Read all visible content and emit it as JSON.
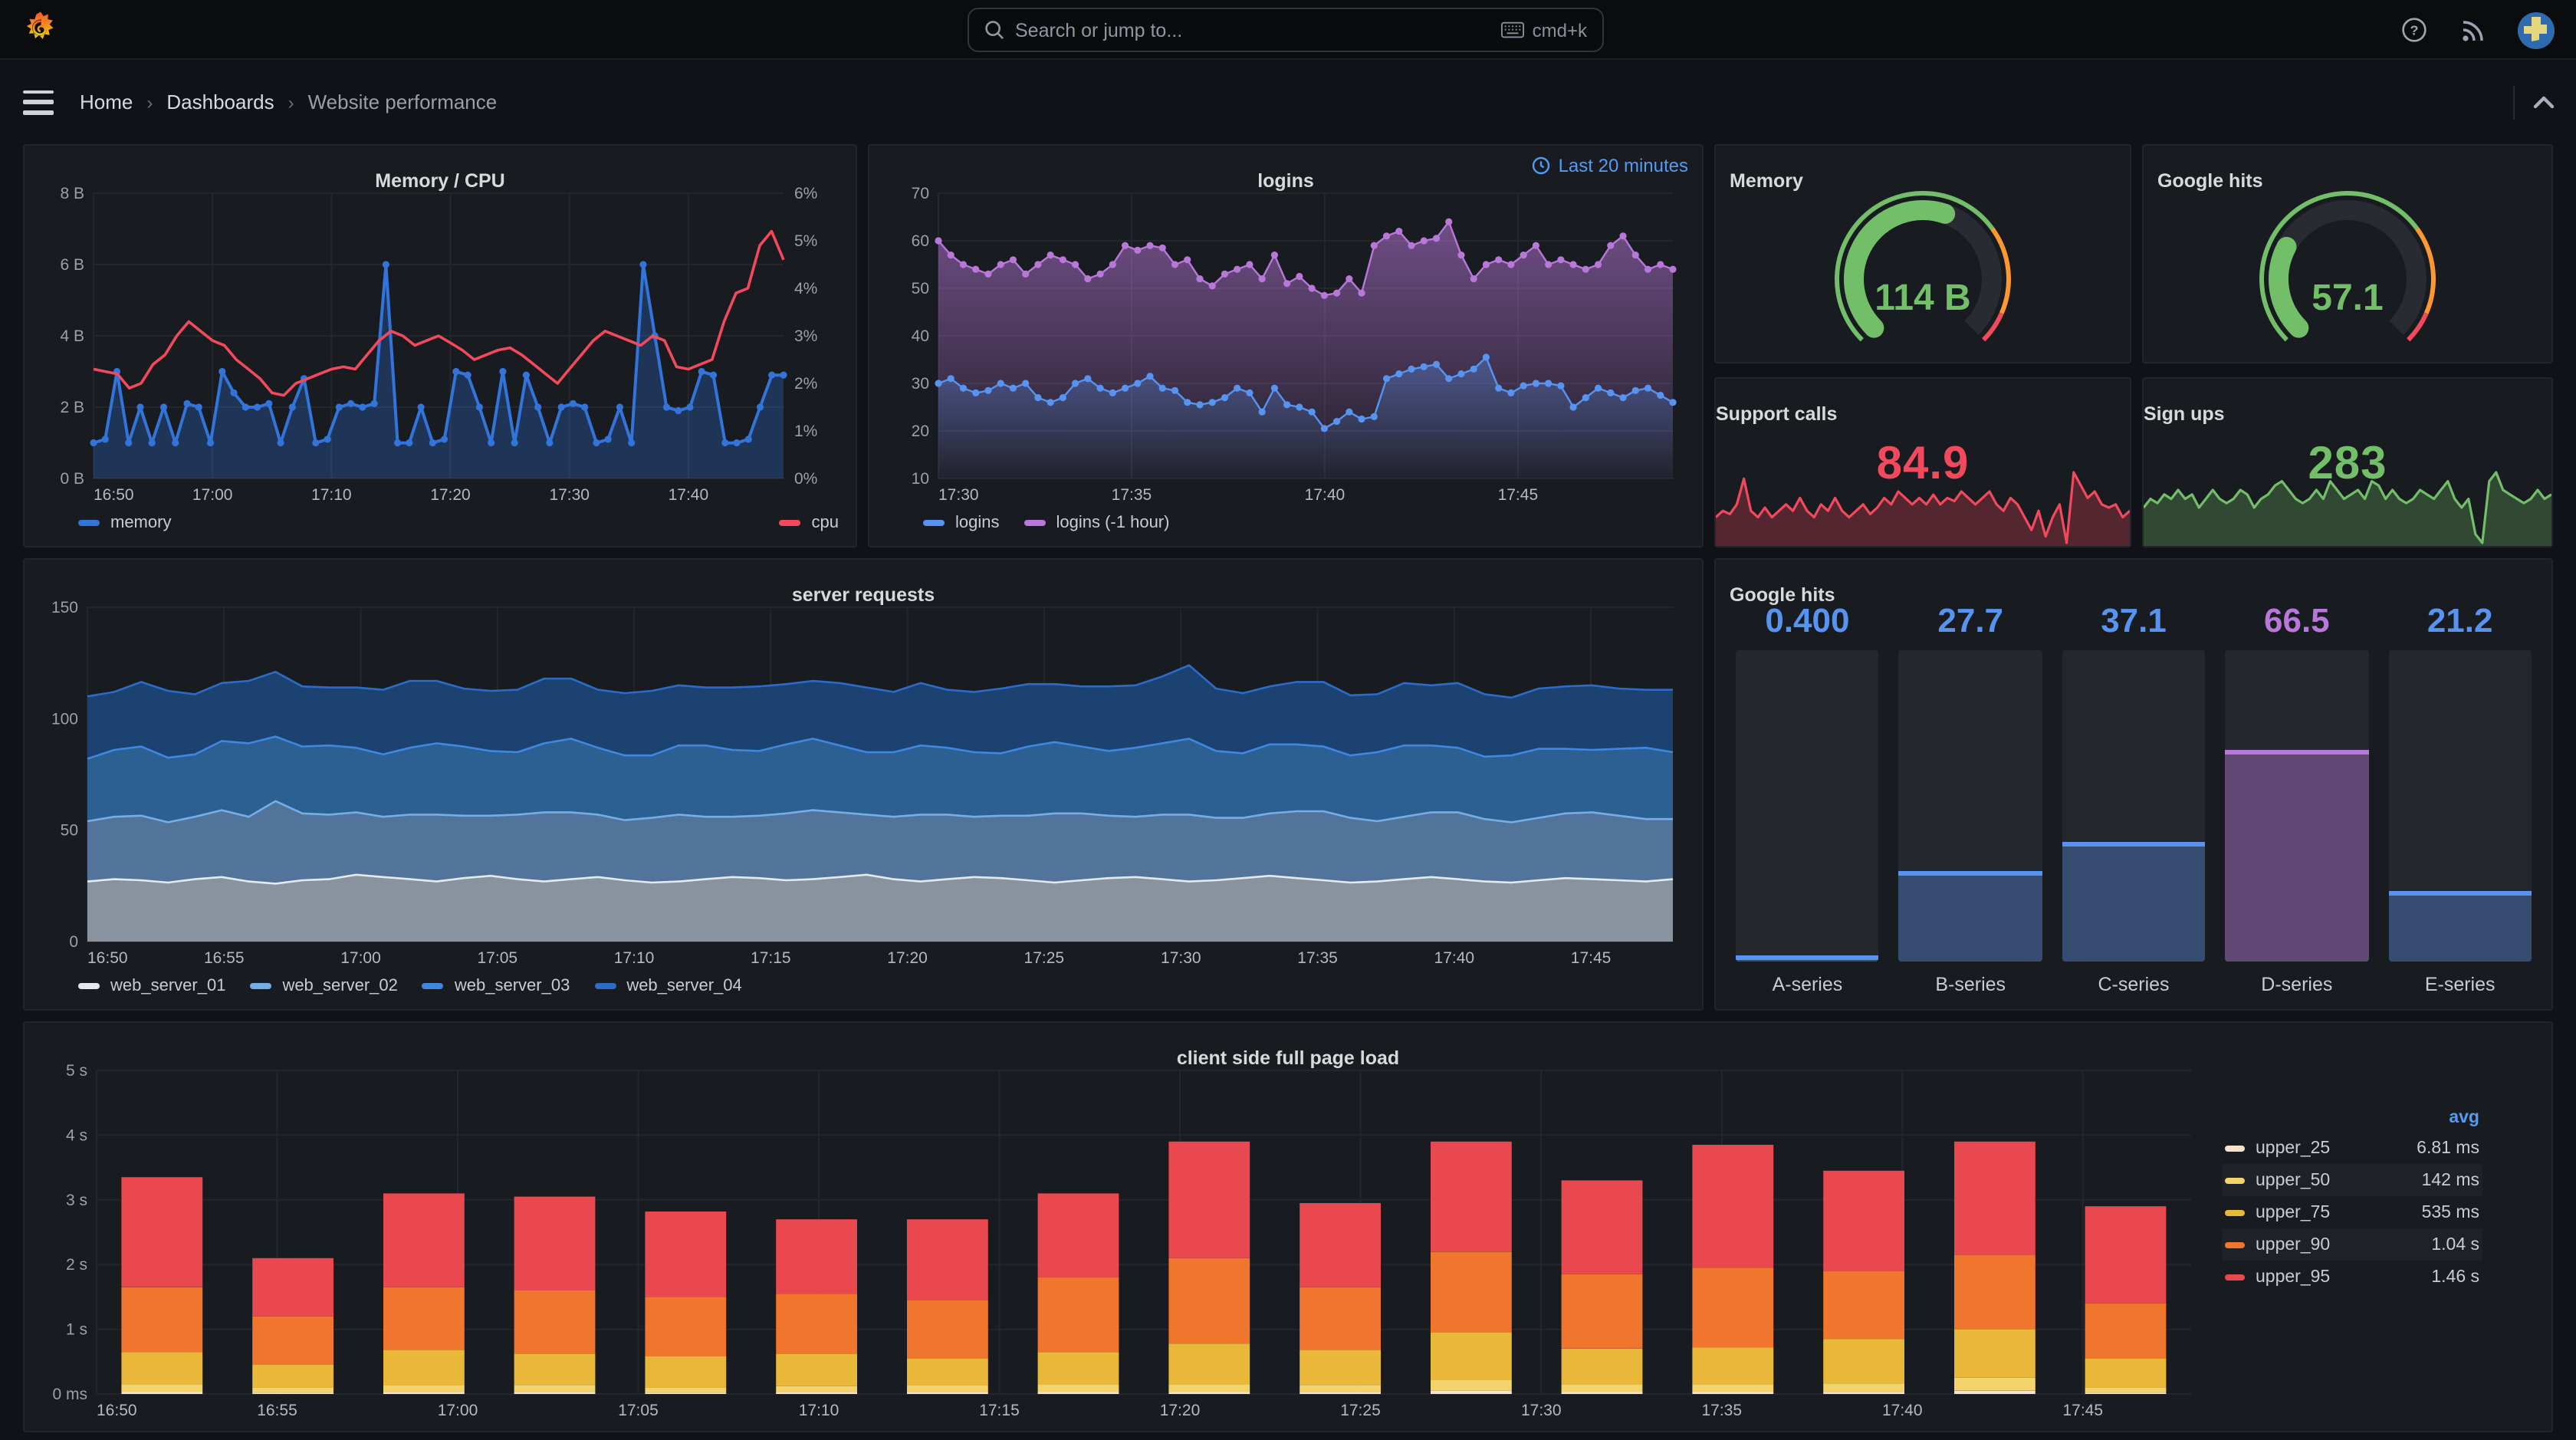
{
  "topnav": {
    "search_placeholder": "Search or jump to...",
    "shortcut": "cmd+k"
  },
  "breadcrumb": {
    "items": [
      "Home",
      "Dashboards",
      "Website performance"
    ]
  },
  "colors": {
    "blue": "#5794F2",
    "dark_blue": "#3274D9",
    "purple": "#B877D9",
    "green": "#73BF69",
    "red": "#F2495C",
    "orange": "#FF780A",
    "yellow": "#EAB839",
    "accent_text": "#539bf5"
  },
  "chart_data": {
    "memory_cpu": {
      "type": "line",
      "title": "Memory / CPU",
      "x_ticks": [
        "16:50",
        "17:00",
        "17:10",
        "17:20",
        "17:30",
        "17:40"
      ],
      "x_tick_fracs": [
        0,
        0.1724,
        0.3448,
        0.5172,
        0.6897,
        0.8621
      ],
      "y_left": {
        "ticks": [
          "0 B",
          "2 B",
          "4 B",
          "6 B",
          "8 B"
        ],
        "min": 0,
        "max": 8
      },
      "y_right": {
        "ticks": [
          "0%",
          "1%",
          "2%",
          "3%",
          "4%",
          "5%",
          "6%"
        ],
        "min": 0,
        "max": 6
      },
      "series": [
        {
          "name": "memory",
          "color": "#3274D9",
          "axis": "left",
          "dots": true,
          "width": 2,
          "fill": "rgba(50,116,217,0.30)",
          "values": [
            1,
            1.1,
            3,
            1,
            2,
            1,
            2,
            1,
            2.1,
            2,
            1,
            3,
            2.4,
            2,
            2,
            2.1,
            1,
            2,
            2.8,
            1,
            1.1,
            2,
            2.1,
            2,
            2.1,
            6,
            1,
            1,
            2,
            1,
            1.1,
            3,
            2.9,
            2,
            1,
            3,
            1,
            2.9,
            2,
            1,
            2,
            2.1,
            2,
            1,
            1.1,
            2,
            1,
            6,
            4,
            2,
            1.9,
            2,
            3,
            2.9,
            1,
            1,
            1.1,
            2,
            2.9,
            2.9
          ]
        },
        {
          "name": "cpu",
          "color": "#F2495C",
          "axis": "right",
          "dots": false,
          "width": 1.8,
          "fill": null,
          "values": [
            2.3,
            2.25,
            2.2,
            1.9,
            2.0,
            2.4,
            2.6,
            3.0,
            3.3,
            3.1,
            2.9,
            2.8,
            2.5,
            2.3,
            2.1,
            1.8,
            1.75,
            2.0,
            2.1,
            2.2,
            2.3,
            2.35,
            2.3,
            2.6,
            2.9,
            3.1,
            3.0,
            2.8,
            2.9,
            3.0,
            2.85,
            2.7,
            2.5,
            2.6,
            2.7,
            2.75,
            2.6,
            2.4,
            2.2,
            2.0,
            2.3,
            2.6,
            2.9,
            3.1,
            3.0,
            2.9,
            2.8,
            3.0,
            2.9,
            2.35,
            2.3,
            2.4,
            2.5,
            3.3,
            3.9,
            4.0,
            4.9,
            5.2,
            4.6
          ]
        }
      ],
      "legend_layout": "split"
    },
    "logins": {
      "type": "line",
      "title": "logins",
      "time_range": "Last 20 minutes",
      "x_ticks": [
        "17:30",
        "17:35",
        "17:40",
        "17:45"
      ],
      "x_tick_fracs": [
        0,
        0.263,
        0.526,
        0.789
      ],
      "y_left": {
        "ticks": [
          "10",
          "20",
          "30",
          "40",
          "50",
          "60",
          "70"
        ],
        "min": 10,
        "max": 70
      },
      "series": [
        {
          "name": "logins (-1 hour)",
          "color": "#B877D9",
          "axis": "left",
          "dots": true,
          "width": 1.2,
          "fill": "gradient:rgba(184,119,217,0.55):rgba(184,119,217,0.05)",
          "values": [
            60,
            57,
            55,
            54,
            53,
            55,
            56,
            53,
            55,
            57,
            56,
            55,
            52,
            53,
            55,
            59,
            58,
            59,
            58.5,
            55,
            56,
            52,
            50.5,
            53,
            54,
            55,
            52,
            57,
            51,
            52.5,
            50,
            48.5,
            49,
            52,
            49,
            59,
            61,
            62,
            59,
            60,
            60.5,
            64,
            57,
            52,
            55,
            56,
            55,
            57,
            59,
            55,
            56,
            55,
            54,
            55,
            59,
            61,
            57,
            54,
            55,
            54
          ],
          "legend_order": 2
        },
        {
          "name": "logins",
          "color": "#5794F2",
          "axis": "left",
          "dots": true,
          "width": 1.2,
          "fill": "gradient:rgba(87,148,242,0.35):rgba(87,148,242,0.02)",
          "values": [
            30,
            31,
            29,
            28,
            28.5,
            30,
            29,
            30,
            27,
            26,
            27,
            30,
            31,
            29,
            28,
            29,
            30,
            31.5,
            29,
            28.5,
            26,
            25.5,
            26,
            27,
            29,
            28,
            24,
            29,
            25.5,
            25,
            24,
            20.5,
            22,
            24,
            22.5,
            23,
            31,
            32,
            33,
            33.5,
            34,
            31,
            32,
            33,
            35.5,
            29,
            28,
            29.5,
            30,
            30,
            29.5,
            25,
            27,
            29,
            28,
            27,
            28.5,
            29,
            27.5,
            26
          ],
          "legend_order": 1
        }
      ],
      "legend_layout": "row"
    },
    "memory_gauge": {
      "type": "gauge",
      "title": "Memory",
      "value": "114 B",
      "fraction": 0.57,
      "value_color": "#73BF69",
      "thresholds": [
        [
          0,
          0.7,
          "#73BF69"
        ],
        [
          0.7,
          0.92,
          "#FF9830"
        ],
        [
          0.92,
          1,
          "#F2495C"
        ]
      ]
    },
    "google_gauge": {
      "type": "gauge",
      "title": "Google hits",
      "value": "57.1",
      "fraction": 0.27,
      "value_color": "#73BF69",
      "thresholds": [
        [
          0,
          0.7,
          "#73BF69"
        ],
        [
          0.7,
          0.92,
          "#FF9830"
        ],
        [
          0.92,
          1,
          "#F2495C"
        ]
      ]
    },
    "support_calls": {
      "type": "stat",
      "title": "Support calls",
      "value": "84.9",
      "color": "#F2495C",
      "spark": [
        12,
        13,
        12.5,
        14,
        18,
        13,
        12,
        13.5,
        12,
        13,
        14,
        13,
        15,
        13,
        12,
        14,
        13,
        15,
        13,
        12,
        13,
        14,
        12.5,
        13.5,
        15,
        14,
        16,
        15,
        14,
        15,
        14,
        15.5,
        14,
        15,
        14.5,
        16,
        15,
        14,
        15,
        16,
        14,
        13,
        15,
        14,
        12,
        10,
        13,
        9,
        12,
        14,
        8,
        19,
        17,
        15,
        16,
        14,
        13.5,
        14,
        12,
        13
      ]
    },
    "sign_ups": {
      "type": "stat",
      "title": "Sign ups",
      "value": "283",
      "color": "#73BF69",
      "spark": [
        6,
        7,
        6.5,
        7.5,
        7,
        8,
        7,
        7.5,
        6,
        7,
        8,
        7,
        6.5,
        7,
        8,
        7.5,
        6,
        7,
        7.5,
        8.5,
        9,
        8,
        7,
        6.5,
        7,
        8,
        7,
        9,
        8,
        7,
        7.5,
        8,
        7,
        9,
        8.5,
        7,
        8,
        7,
        6.5,
        7,
        8,
        7.5,
        7,
        8,
        9,
        7,
        6,
        7,
        3,
        2,
        9,
        10,
        8,
        7.5,
        7,
        6.5,
        7,
        8,
        7,
        7.5
      ]
    },
    "server_requests": {
      "type": "area",
      "title": "server requests",
      "x_ticks": [
        "16:50",
        "16:55",
        "17:00",
        "17:05",
        "17:10",
        "17:15",
        "17:20",
        "17:25",
        "17:30",
        "17:35",
        "17:40",
        "17:45"
      ],
      "x_tick_fracs": [
        0,
        0.0862,
        0.1724,
        0.2586,
        0.3448,
        0.431,
        0.5172,
        0.6034,
        0.6897,
        0.7759,
        0.8621,
        0.9483
      ],
      "y_left": {
        "ticks": [
          "0",
          "50",
          "100",
          "150"
        ],
        "min": 0,
        "max": 150
      },
      "series": [
        {
          "name": "web_server_01",
          "color": "#E4E9EE",
          "fill": "#88939F",
          "values": [
            27,
            28,
            27.5,
            26.5,
            28,
            29,
            27,
            26,
            27.5,
            28,
            30,
            29,
            28,
            27,
            28.5,
            29.5,
            28,
            27,
            28,
            29,
            27.5,
            26.5,
            27,
            28,
            29,
            28.5,
            27.5,
            28,
            29,
            30,
            28,
            27,
            28,
            29,
            28.5,
            27.5,
            26.5,
            27.5,
            28.5,
            29,
            28,
            27,
            27.5,
            28.5,
            29.5,
            28.5,
            27.5,
            26.5,
            27,
            28,
            29,
            28,
            27,
            26.5,
            27.5,
            28.5,
            28,
            27.5,
            27,
            28
          ]
        },
        {
          "name": "web_server_02",
          "color": "#74AEE8",
          "fill": "#52749B",
          "values": [
            27,
            28,
            29,
            27,
            28,
            30,
            29,
            37,
            30,
            29,
            28,
            27,
            29,
            30,
            28,
            27,
            29,
            31,
            30,
            28,
            27,
            29,
            30,
            28,
            27,
            28,
            30,
            31,
            29,
            27,
            28,
            30,
            29,
            27,
            28,
            29,
            31,
            30,
            28,
            27,
            29,
            30,
            28,
            27,
            28,
            30,
            31,
            29,
            27,
            28,
            29,
            30,
            28,
            27,
            28,
            29,
            30,
            29,
            28,
            27
          ]
        },
        {
          "name": "web_server_03",
          "color": "#3F87E0",
          "fill": "#2C5F92",
          "values": [
            28,
            30,
            31,
            29,
            28,
            31,
            33,
            29,
            30,
            31,
            29,
            28,
            30,
            32,
            31,
            29,
            28,
            31,
            33,
            30,
            29,
            28,
            31,
            32,
            30,
            29,
            31,
            32,
            30,
            28,
            29,
            31,
            30,
            29,
            28,
            31,
            32,
            30,
            29,
            31,
            32,
            34,
            30,
            29,
            31,
            30,
            29,
            28,
            31,
            32,
            30,
            29,
            28,
            30,
            31,
            29,
            28,
            30,
            32,
            30
          ]
        },
        {
          "name": "web_server_04",
          "color": "#2C6BC8",
          "fill": "#1B4270",
          "values": [
            28,
            26,
            29,
            30,
            27,
            26,
            28,
            29,
            27,
            26,
            27,
            29,
            30,
            28,
            26,
            27,
            28,
            29,
            27,
            26,
            28,
            29,
            27,
            26,
            28,
            29,
            27,
            26,
            28,
            29,
            27,
            28,
            26,
            27,
            29,
            28,
            26,
            27,
            29,
            28,
            30,
            33,
            28,
            27,
            26,
            28,
            29,
            27,
            26,
            28,
            27,
            29,
            28,
            26,
            27,
            28,
            29,
            27,
            26,
            28
          ]
        }
      ],
      "legend_layout": "row"
    },
    "google_bars": {
      "type": "bargauge",
      "title": "Google hits",
      "max": 100,
      "bars": [
        {
          "label": "A-series",
          "display": "0.400",
          "value": 0.4,
          "color": "#5794F2",
          "fill": "rgba(87,148,242,0.35)"
        },
        {
          "label": "B-series",
          "display": "27.7",
          "value": 27.7,
          "color": "#5794F2",
          "fill": "rgba(87,148,242,0.35)"
        },
        {
          "label": "C-series",
          "display": "37.1",
          "value": 37.1,
          "color": "#5794F2",
          "fill": "rgba(87,148,242,0.35)"
        },
        {
          "label": "D-series",
          "display": "66.5",
          "value": 66.5,
          "color": "#B877D9",
          "fill": "rgba(184,119,217,0.42)"
        },
        {
          "label": "E-series",
          "display": "21.2",
          "value": 21.2,
          "color": "#5794F2",
          "fill": "rgba(87,148,242,0.35)"
        }
      ]
    },
    "page_load": {
      "type": "stacked-bar",
      "title": "client side full page load",
      "x_ticks": [
        "16:50",
        "16:55",
        "17:00",
        "17:05",
        "17:10",
        "17:15",
        "17:20",
        "17:25",
        "17:30",
        "17:35",
        "17:40",
        "17:45"
      ],
      "x_tick_fracs": [
        0,
        0.0862,
        0.1724,
        0.2586,
        0.3448,
        0.431,
        0.5172,
        0.6034,
        0.6897,
        0.7759,
        0.8621,
        0.9483
      ],
      "y_left": {
        "ticks": [
          "0 ms",
          "1 s",
          "2 s",
          "3 s",
          "4 s",
          "5 s"
        ],
        "min": 0,
        "max": 5
      },
      "series_names": [
        "upper_25",
        "upper_50",
        "upper_75",
        "upper_90",
        "upper_95"
      ],
      "series_colors": [
        "#F5E3D0",
        "#F3D36B",
        "#EAB839",
        "#F0762D",
        "#E8484E"
      ],
      "stacks": [
        [
          0.03,
          0.15,
          0.65,
          1.65,
          3.35
        ],
        [
          0.02,
          0.1,
          0.45,
          1.2,
          2.1
        ],
        [
          0.03,
          0.13,
          0.68,
          1.65,
          3.1
        ],
        [
          0.03,
          0.14,
          0.62,
          1.6,
          3.05
        ],
        [
          0.02,
          0.1,
          0.58,
          1.5,
          2.82
        ],
        [
          0.03,
          0.12,
          0.62,
          1.55,
          2.7
        ],
        [
          0.03,
          0.13,
          0.55,
          1.45,
          2.7
        ],
        [
          0.03,
          0.15,
          0.65,
          1.8,
          3.1
        ],
        [
          0.03,
          0.15,
          0.78,
          2.1,
          3.9
        ],
        [
          0.03,
          0.14,
          0.68,
          1.65,
          2.95
        ],
        [
          0.05,
          0.22,
          0.95,
          2.2,
          3.9
        ],
        [
          0.03,
          0.15,
          0.7,
          1.85,
          3.3
        ],
        [
          0.03,
          0.15,
          0.72,
          1.95,
          3.85
        ],
        [
          0.03,
          0.16,
          0.85,
          1.9,
          3.45
        ],
        [
          0.05,
          0.25,
          1.0,
          2.15,
          3.9
        ],
        [
          0.02,
          0.1,
          0.55,
          1.4,
          2.9
        ]
      ],
      "legend": {
        "header": "avg",
        "rows": [
          {
            "name": "upper_25",
            "value": "6.81 ms"
          },
          {
            "name": "upper_50",
            "value": "142 ms"
          },
          {
            "name": "upper_75",
            "value": "535 ms"
          },
          {
            "name": "upper_90",
            "value": "1.04 s"
          },
          {
            "name": "upper_95",
            "value": "1.46 s"
          }
        ]
      }
    }
  }
}
